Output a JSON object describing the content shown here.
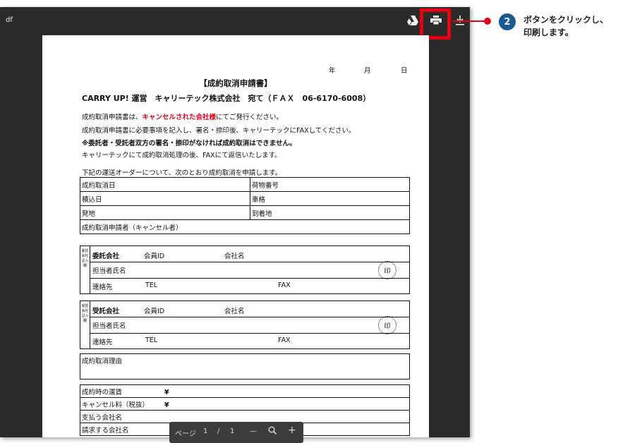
{
  "viewer": {
    "title_fragment": "df"
  },
  "toolbar": {
    "drive_icon": "google-drive-add-icon",
    "print_icon": "printer-icon",
    "download_icon": "download-icon"
  },
  "callout": {
    "step_number": "2",
    "text_line1": "ボタンをクリックし、",
    "text_line2": "印刷します。",
    "highlight_color": "#e60012",
    "badge_color": "#1a5a94"
  },
  "document": {
    "date_year": "年",
    "date_month": "月",
    "date_day": "日",
    "title": "【成約取消申請書】",
    "to_line": "CARRY UP! 運営　キャリーテック株式会社　宛て（ＦＡＸ　06-6170-6008）",
    "intro1_pre": "成約取消申請書は、",
    "intro1_red": "キャンセルされた会社様",
    "intro1_post": "にてご発行ください。",
    "intro2": "成約取消申請書に必要事項を記入し、署名・捺印後、キャリーテックにFAXしてください。",
    "intro3": "※委託者・受託者双方の署名・捺印がなければ成約取消はできません。",
    "intro4": "キャリーテックにて成約取消処理の後、FAXにて返信いたします。",
    "request_line": "下記の運送オーダーについて、次のとおり成約取消を申請します。",
    "table1": {
      "cancel_date": "成約取消日",
      "cargo_number": "荷物番号",
      "load_date": "積込日",
      "vehicle_type": "車格",
      "origin": "発地",
      "destination": "到着地",
      "applicant": "成約取消申請者（キャンセル者）"
    },
    "consignor": {
      "side_label": "委託会社記入欄",
      "company_label": "委託会社",
      "member_id": "会員ID",
      "company_name": "会社名",
      "person": "担当者氏名",
      "stamp": "印",
      "contact": "連絡先",
      "tel": "TEL",
      "fax": "FAX"
    },
    "consignee": {
      "side_label": "受託会社記入欄",
      "company_label": "受託会社",
      "member_id": "会員ID",
      "company_name": "会社名",
      "person": "担当者氏名",
      "stamp": "印",
      "contact": "連絡先",
      "tel": "TEL",
      "fax": "FAX"
    },
    "reason_label": "成約取消理由",
    "fees": {
      "fare": "成約時の運賃",
      "fare_yen": "¥",
      "cancel_fee": "キャンセル料（税抜）",
      "cancel_fee_yen": "¥",
      "payer": "支払う会社名",
      "biller": "請求する会社名"
    }
  },
  "pager": {
    "page_label": "ページ",
    "current": "1",
    "separator": "/",
    "total": "1",
    "zoom_out": "—",
    "zoom_in": "+",
    "zoom_icon": "zoom-icon"
  }
}
